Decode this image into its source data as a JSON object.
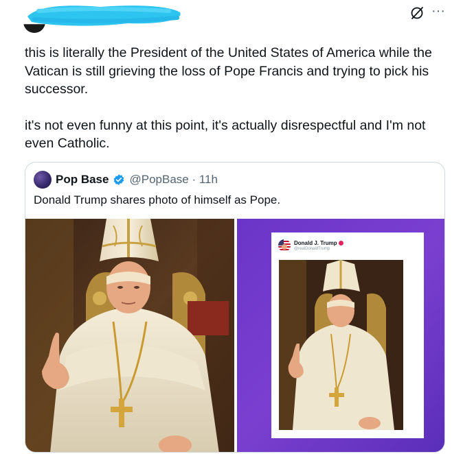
{
  "header": {
    "more_label": "···"
  },
  "tweet": {
    "paragraph_1": "this is literally the President of the United States of America while the Vatican is still grieving the loss of Pope Francis and trying to pick his successor.",
    "paragraph_2": "it's not even funny at this point, it's actually disrespectful and I'm not even Catholic."
  },
  "quote": {
    "name": "Pop Base",
    "handle": "@PopBase · 11h",
    "text": "Donald Trump shares photo of himself as Pope.",
    "verified_color": "#1d9bf0"
  },
  "embedded_tweet": {
    "name": "Donald J. Trump",
    "handle": "@realDonaldTrump",
    "badge_color": "#e0245e"
  },
  "colors": {
    "text": "#0f1419",
    "secondary": "#536471",
    "border": "#cfd9de",
    "purple_bg": "#6a35c8",
    "redaction": "#2ec4f0"
  },
  "icons": {
    "mute": "mute-icon",
    "more": "more-icon",
    "verified": "verified-badge-icon"
  }
}
